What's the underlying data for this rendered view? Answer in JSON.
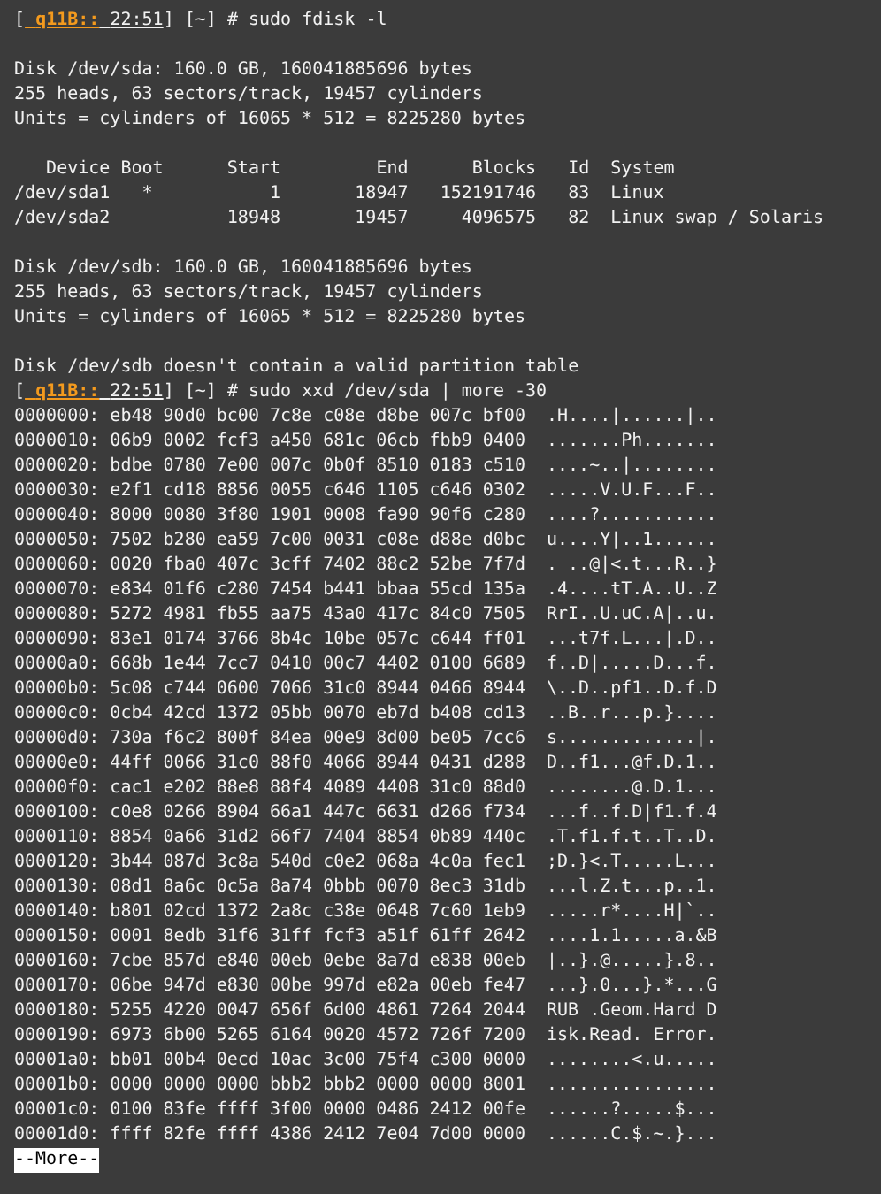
{
  "terminal": {
    "lines": [
      {
        "kind": "prompt",
        "lead": "[",
        "host": "q11B::",
        "time": "22:51",
        "rest": "] [~] # sudo fdisk -l"
      },
      {
        "kind": "gap"
      },
      {
        "kind": "text",
        "text": "Disk /dev/sda: 160.0 GB, 160041885696 bytes"
      },
      {
        "kind": "text",
        "text": "255 heads, 63 sectors/track, 19457 cylinders"
      },
      {
        "kind": "text",
        "text": "Units = cylinders of 16065 * 512 = 8225280 bytes"
      },
      {
        "kind": "gap"
      },
      {
        "kind": "text",
        "text": "   Device Boot      Start         End      Blocks   Id  System"
      },
      {
        "kind": "text",
        "text": "/dev/sda1   *           1       18947   152191746   83  Linux"
      },
      {
        "kind": "text",
        "text": "/dev/sda2           18948       19457     4096575   82  Linux swap / Solaris"
      },
      {
        "kind": "gap"
      },
      {
        "kind": "text",
        "text": "Disk /dev/sdb: 160.0 GB, 160041885696 bytes"
      },
      {
        "kind": "text",
        "text": "255 heads, 63 sectors/track, 19457 cylinders"
      },
      {
        "kind": "text",
        "text": "Units = cylinders of 16065 * 512 = 8225280 bytes"
      },
      {
        "kind": "gap"
      },
      {
        "kind": "text",
        "text": "Disk /dev/sdb doesn't contain a valid partition table"
      },
      {
        "kind": "prompt",
        "lead": "[",
        "host": "q11B::",
        "time": "22:51",
        "rest": "] [~] # sudo xxd /dev/sda | more -30"
      },
      {
        "kind": "hex",
        "offset": "0000000:",
        "hex": "eb48 90d0 bc00 7c8e c08e d8be 007c bf00",
        "ascii": ".H....|......|.."
      },
      {
        "kind": "hex",
        "offset": "0000010:",
        "hex": "06b9 0002 fcf3 a450 681c 06cb fbb9 0400",
        "ascii": ".......Ph......."
      },
      {
        "kind": "hex",
        "offset": "0000020:",
        "hex": "bdbe 0780 7e00 007c 0b0f 8510 0183 c510",
        "ascii": "....~..|........"
      },
      {
        "kind": "hex",
        "offset": "0000030:",
        "hex": "e2f1 cd18 8856 0055 c646 1105 c646 0302",
        "ascii": ".....V.U.F...F.."
      },
      {
        "kind": "hex",
        "offset": "0000040:",
        "hex": "8000 0080 3f80 1901 0008 fa90 90f6 c280",
        "ascii": "....?..........."
      },
      {
        "kind": "hex",
        "offset": "0000050:",
        "hex": "7502 b280 ea59 7c00 0031 c08e d88e d0bc",
        "ascii": "u....Y|..1......"
      },
      {
        "kind": "hex",
        "offset": "0000060:",
        "hex": "0020 fba0 407c 3cff 7402 88c2 52be 7f7d",
        "ascii": ". ..@|<.t...R..}"
      },
      {
        "kind": "hex",
        "offset": "0000070:",
        "hex": "e834 01f6 c280 7454 b441 bbaa 55cd 135a",
        "ascii": ".4....tT.A..U..Z"
      },
      {
        "kind": "hex",
        "offset": "0000080:",
        "hex": "5272 4981 fb55 aa75 43a0 417c 84c0 7505",
        "ascii": "RrI..U.uC.A|..u."
      },
      {
        "kind": "hex",
        "offset": "0000090:",
        "hex": "83e1 0174 3766 8b4c 10be 057c c644 ff01",
        "ascii": "...t7f.L...|.D.."
      },
      {
        "kind": "hex",
        "offset": "00000a0:",
        "hex": "668b 1e44 7cc7 0410 00c7 4402 0100 6689",
        "ascii": "f..D|.....D...f."
      },
      {
        "kind": "hex",
        "offset": "00000b0:",
        "hex": "5c08 c744 0600 7066 31c0 8944 0466 8944",
        "ascii": "\\..D..pf1..D.f.D"
      },
      {
        "kind": "hex",
        "offset": "00000c0:",
        "hex": "0cb4 42cd 1372 05bb 0070 eb7d b408 cd13",
        "ascii": "..B..r...p.}...."
      },
      {
        "kind": "hex",
        "offset": "00000d0:",
        "hex": "730a f6c2 800f 84ea 00e9 8d00 be05 7cc6",
        "ascii": "s.............|."
      },
      {
        "kind": "hex",
        "offset": "00000e0:",
        "hex": "44ff 0066 31c0 88f0 4066 8944 0431 d288",
        "ascii": "D..f1...@f.D.1.."
      },
      {
        "kind": "hex",
        "offset": "00000f0:",
        "hex": "cac1 e202 88e8 88f4 4089 4408 31c0 88d0",
        "ascii": "........@.D.1..."
      },
      {
        "kind": "hex",
        "offset": "0000100:",
        "hex": "c0e8 0266 8904 66a1 447c 6631 d266 f734",
        "ascii": "...f..f.D|f1.f.4"
      },
      {
        "kind": "hex",
        "offset": "0000110:",
        "hex": "8854 0a66 31d2 66f7 7404 8854 0b89 440c",
        "ascii": ".T.f1.f.t..T..D."
      },
      {
        "kind": "hex",
        "offset": "0000120:",
        "hex": "3b44 087d 3c8a 540d c0e2 068a 4c0a fec1",
        "ascii": ";D.}<.T.....L..."
      },
      {
        "kind": "hex",
        "offset": "0000130:",
        "hex": "08d1 8a6c 0c5a 8a74 0bbb 0070 8ec3 31db",
        "ascii": "...l.Z.t...p..1."
      },
      {
        "kind": "hex",
        "offset": "0000140:",
        "hex": "b801 02cd 1372 2a8c c38e 0648 7c60 1eb9",
        "ascii": ".....r*....H|`.."
      },
      {
        "kind": "hex",
        "offset": "0000150:",
        "hex": "0001 8edb 31f6 31ff fcf3 a51f 61ff 2642",
        "ascii": "....1.1.....a.&B"
      },
      {
        "kind": "hex",
        "offset": "0000160:",
        "hex": "7cbe 857d e840 00eb 0ebe 8a7d e838 00eb",
        "ascii": "|..}.@.....}.8.."
      },
      {
        "kind": "hex",
        "offset": "0000170:",
        "hex": "06be 947d e830 00be 997d e82a 00eb fe47",
        "ascii": "...}.0...}.*...G"
      },
      {
        "kind": "hex",
        "offset": "0000180:",
        "hex": "5255 4220 0047 656f 6d00 4861 7264 2044",
        "ascii": "RUB .Geom.Hard D"
      },
      {
        "kind": "hex",
        "offset": "0000190:",
        "hex": "6973 6b00 5265 6164 0020 4572 726f 7200",
        "ascii": "isk.Read. Error."
      },
      {
        "kind": "hex",
        "offset": "00001a0:",
        "hex": "bb01 00b4 0ecd 10ac 3c00 75f4 c300 0000",
        "ascii": "........<.u....."
      },
      {
        "kind": "hex",
        "offset": "00001b0:",
        "hex": "0000 0000 0000 bbb2 bbb2 0000 0000 8001",
        "ascii": "................"
      },
      {
        "kind": "hex",
        "offset": "00001c0:",
        "hex": "0100 83fe ffff 3f00 0000 0486 2412 00fe",
        "ascii": "......?.....$..."
      },
      {
        "kind": "hex",
        "offset": "00001d0:",
        "hex": "ffff 82fe ffff 4386 2412 7e04 7d00 0000",
        "ascii": "......C.$.~.}..."
      },
      {
        "kind": "pager",
        "text": "--More--"
      }
    ]
  }
}
